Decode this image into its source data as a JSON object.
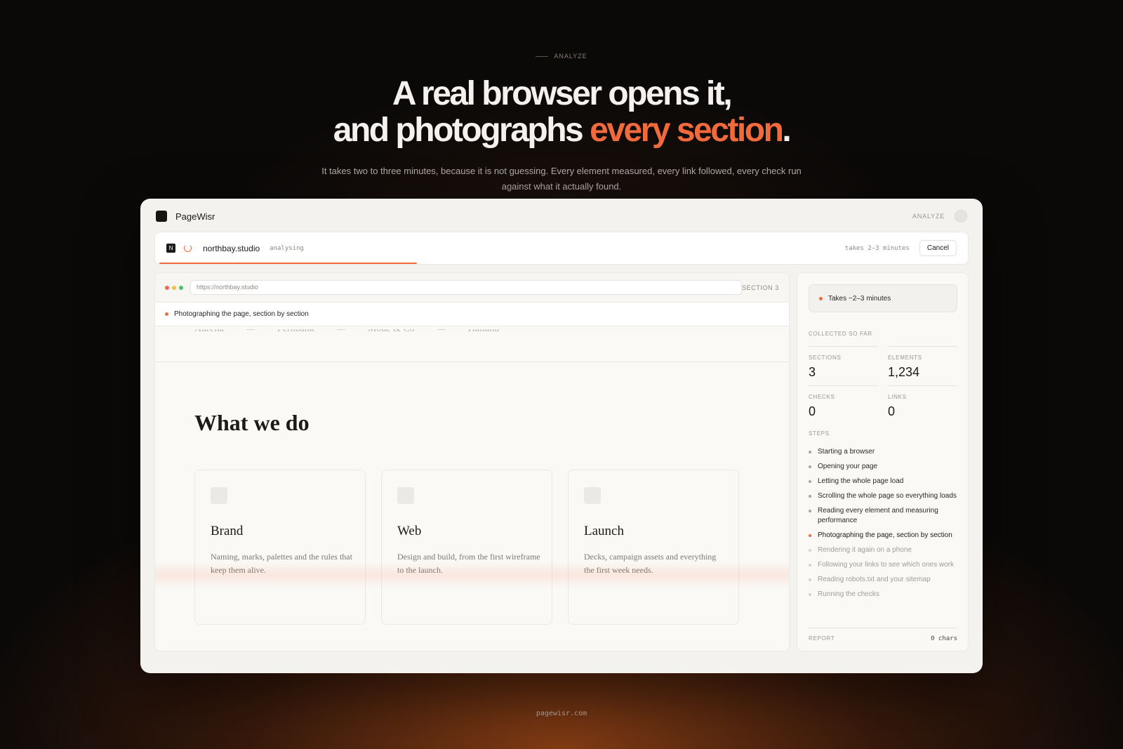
{
  "hero": {
    "eyebrow": "ANALYZE",
    "headline_line1": "A real browser opens it,",
    "headline_line2_plain": "and photographs ",
    "headline_line2_accent": "every section",
    "headline_line2_end": ".",
    "subtext": "It takes two to three minutes, because it is not guessing. Every element measured, every link followed, every check run against what it actually found."
  },
  "footer": {
    "domain": "pagewisr.com"
  },
  "app": {
    "name": "PageWisr",
    "nav_label": "ANALYZE",
    "progress": {
      "favicon_letter": "N",
      "domain": "northbay.studio",
      "status": "analysing",
      "eta": "takes 2–3 minutes",
      "cancel_label": "Cancel",
      "fraction": 0.32
    },
    "preview": {
      "url": "https://northbay.studio",
      "section_tag": "SECTION 3",
      "status_text": "Photographing the page, section by section",
      "clients": [
        "Aurelia",
        "Fernbank",
        "Mode & Co",
        "Halland"
      ],
      "section_title": "What we do",
      "cards": [
        {
          "title": "Brand",
          "desc": "Naming, marks, palettes and the rules that keep them alive."
        },
        {
          "title": "Web",
          "desc": "Design and build, from the first wireframe to the launch."
        },
        {
          "title": "Launch",
          "desc": "Decks, campaign assets and everything the first week needs."
        }
      ]
    },
    "panel": {
      "eta_text": "Takes ~2–3 minutes",
      "collected_label": "COLLECTED SO FAR",
      "stats": [
        {
          "label": "SECTIONS",
          "value": "3"
        },
        {
          "label": "ELEMENTS",
          "value": "1,234"
        },
        {
          "label": "CHECKS",
          "value": "0"
        },
        {
          "label": "LINKS",
          "value": "0"
        }
      ],
      "steps_label": "STEPS",
      "steps": [
        {
          "label": "Starting a browser",
          "state": "done"
        },
        {
          "label": "Opening your page",
          "state": "done"
        },
        {
          "label": "Letting the whole page load",
          "state": "done"
        },
        {
          "label": "Scrolling the whole page so everything loads",
          "state": "done"
        },
        {
          "label": "Reading every element and measuring performance",
          "state": "done"
        },
        {
          "label": "Photographing the page, section by section",
          "state": "active"
        },
        {
          "label": "Rendering it again on a phone",
          "state": "pending"
        },
        {
          "label": "Following your links to see which ones work",
          "state": "pending"
        },
        {
          "label": "Reading robots.txt and your sitemap",
          "state": "pending"
        },
        {
          "label": "Running the checks",
          "state": "pending"
        }
      ],
      "report_label": "REPORT",
      "report_chars": "0 chars"
    }
  },
  "colors": {
    "accent": "#f06a3b",
    "background": "#0b0908",
    "window": "#f3f2ef"
  }
}
